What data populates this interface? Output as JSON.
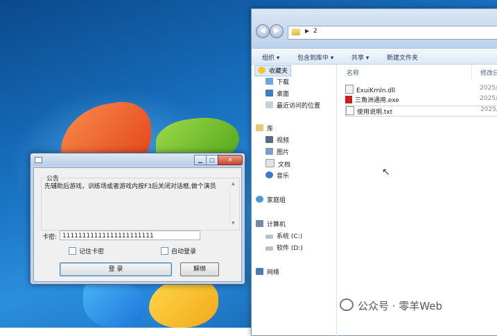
{
  "explorer": {
    "address_path": "2",
    "toolbar": [
      "组织 ▾",
      "包含到库中 ▾",
      "共享 ▾",
      "新建文件夹"
    ],
    "columns": {
      "name": "名称",
      "date": "修改日"
    },
    "nav": {
      "favorites": "收藏夹",
      "favorites_items": [
        "下载",
        "桌面",
        "最近访问的位置"
      ],
      "libraries": "库",
      "libraries_items": [
        "视频",
        "图片",
        "文档",
        "音乐"
      ],
      "homegroup": "家庭组",
      "computer": "计算机",
      "computer_items": [
        "系统 (C:)",
        "软件 (D:)"
      ],
      "network": "网络"
    },
    "files": [
      {
        "name": "ExuiKrnln.dll",
        "date": "2025/"
      },
      {
        "name": "三角洲通用.exe",
        "date": "2025/"
      },
      {
        "name": "使用说明.txt",
        "date": "2025/"
      }
    ]
  },
  "dialog": {
    "group_label": "公告",
    "notice_text": "先辅助后游戏，训练场或者游戏内按F3后关闭对话框,做个演员",
    "password_label": "卡密:",
    "password_value": "11111111111111111111111",
    "remember_label": "记住卡密",
    "autologin_label": "自动登录",
    "login_button": "登 录",
    "unbind_button": "解绑",
    "caption_buttons": [
      "▁",
      "□",
      "✕"
    ]
  },
  "watermark": "公众号 · 零羊Web"
}
